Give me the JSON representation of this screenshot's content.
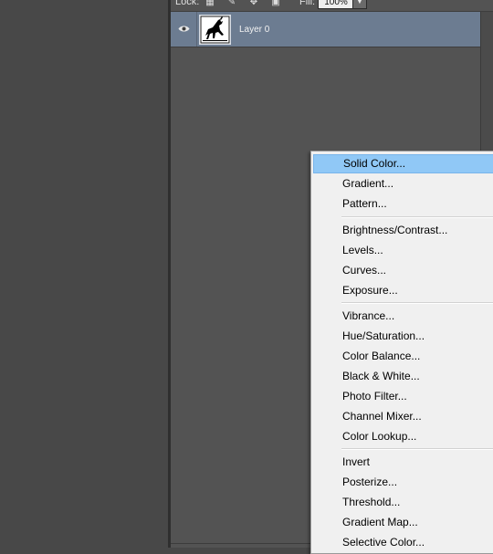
{
  "toolbar": {
    "lock_label": "Lock:",
    "lock_icons": [
      "lock-transparent-pixels-icon",
      "lock-image-pixels-icon",
      "lock-position-icon",
      "lock-all-icon"
    ],
    "fill_label": "Fill:",
    "fill_value": "100%"
  },
  "layers": [
    {
      "name": "Layer 0",
      "visible": true,
      "selected": true
    }
  ],
  "colors": {
    "panel_bg": "#535353",
    "canvas_bg": "#484848",
    "selected_layer": "#6c7c91",
    "menu_bg": "#f0f0f0",
    "menu_highlight": "#90c8f6"
  },
  "menu": {
    "groups": [
      [
        "Solid Color...",
        "Gradient...",
        "Pattern..."
      ],
      [
        "Brightness/Contrast...",
        "Levels...",
        "Curves...",
        "Exposure..."
      ],
      [
        "Vibrance...",
        "Hue/Saturation...",
        "Color Balance...",
        "Black & White...",
        "Photo Filter...",
        "Channel Mixer...",
        "Color Lookup..."
      ],
      [
        "Invert",
        "Posterize...",
        "Threshold...",
        "Gradient Map...",
        "Selective Color..."
      ]
    ],
    "highlighted": "Solid Color..."
  }
}
